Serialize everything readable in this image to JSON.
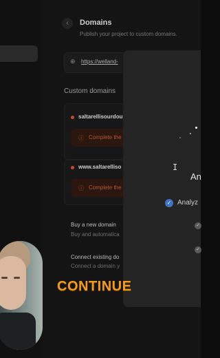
{
  "header": {
    "title": "Domains",
    "subtitle": "Publish your project to custom domains.",
    "back_icon": "‹"
  },
  "published_url": {
    "text": "https://welland-",
    "icon": "globe-icon"
  },
  "custom_domains": {
    "section_title": "Custom domains",
    "items": [
      {
        "name": "saltarellisourdou",
        "warning": "Complete the"
      },
      {
        "name": "www.saltarelliso",
        "warning": "Complete the"
      }
    ]
  },
  "options": [
    {
      "title": "Buy a new domain",
      "desc": "Buy and automatica"
    },
    {
      "title": "Connect existing do",
      "desc": "Connect a domain y"
    }
  ],
  "modal": {
    "heading": "An",
    "step_label": "Analyz",
    "cursor": "I",
    "check_glyph": "✓"
  },
  "overlay": {
    "caption": "CONTINUE",
    "caption_color": "#f39a1f"
  }
}
